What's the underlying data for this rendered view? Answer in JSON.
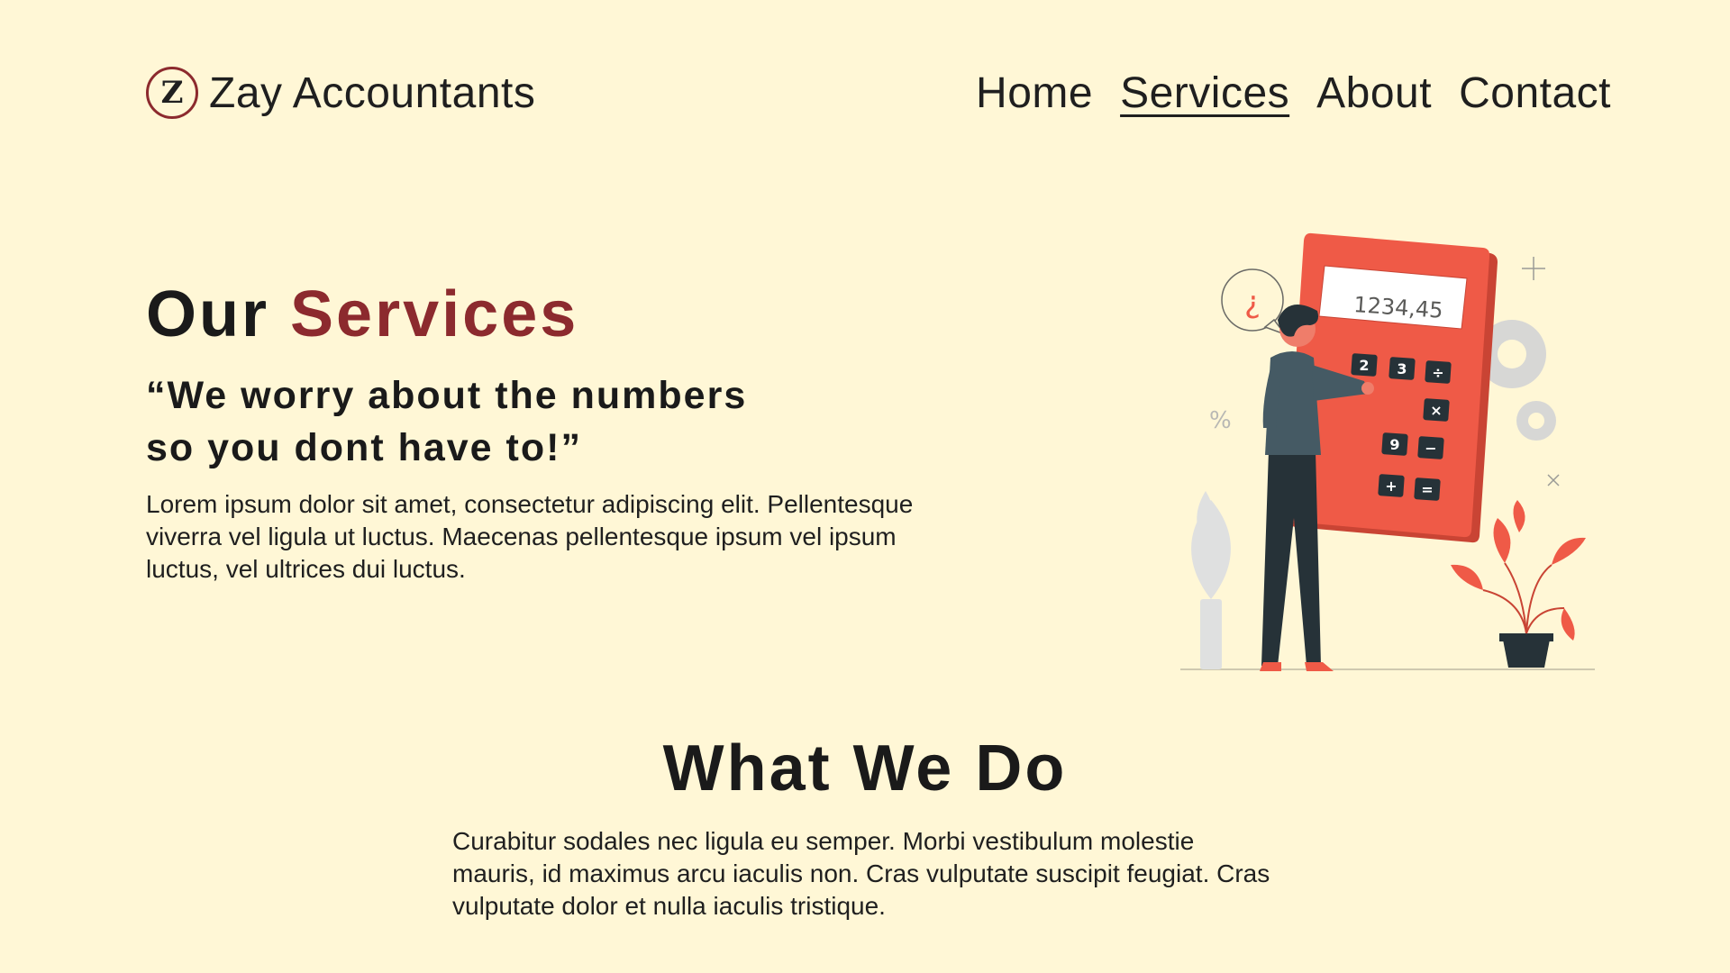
{
  "header": {
    "logo_letter": "Z",
    "brand_name": "Zay Accountants",
    "nav": [
      "Home",
      "Services",
      "About",
      "Contact"
    ],
    "active_nav": "Services"
  },
  "hero": {
    "title_part1": "Our",
    "title_part2": "Services",
    "tagline_line1": "“We worry about the numbers",
    "tagline_line2": "so you dont have to!”",
    "body": "Lorem ipsum dolor sit amet, consectetur adipiscing elit. Pellentesque viverra vel ligula ut luctus. Maecenas pellentesque ipsum vel ipsum luctus, vel ultrices dui luctus.",
    "calculator_display": "1234,45",
    "calculator_keys": [
      "2",
      "3",
      "÷",
      "×",
      "9",
      "−",
      "+",
      "="
    ],
    "speech_bubble": "¿"
  },
  "what_we_do": {
    "title": "What We Do",
    "body": "Curabitur sodales nec ligula eu semper. Morbi vestibulum molestie mauris, id maximus arcu iaculis non. Cras vulputate suscipit feugiat. Cras vulputate dolor et nulla iaculis tristique."
  },
  "colors": {
    "background": "#fff7d6",
    "accent": "#8c2a2e",
    "calculator": "#ef5a47",
    "text": "#1f1f1f"
  }
}
